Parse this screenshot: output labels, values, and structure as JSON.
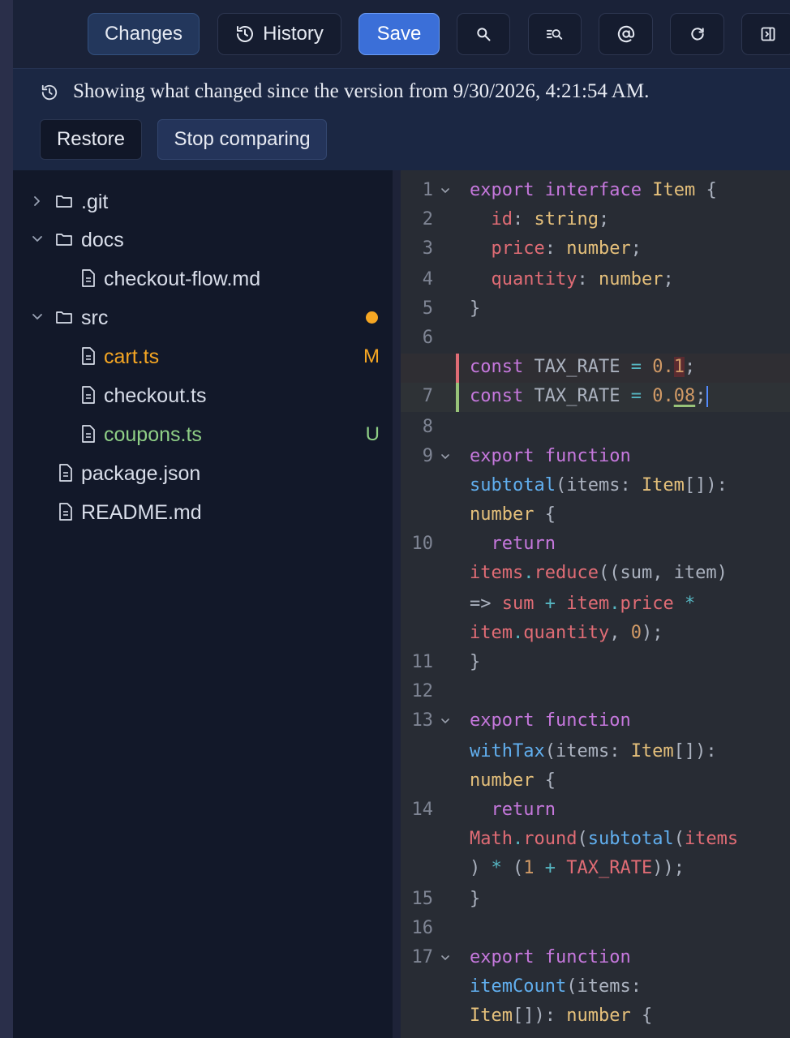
{
  "toolbar": {
    "changes_label": "Changes",
    "history_label": "History",
    "save_label": "Save"
  },
  "banner": {
    "message": "Showing what changed since the version from 9/30/2026, 4:21:54 AM.",
    "restore_label": "Restore",
    "stop_label": "Stop comparing"
  },
  "tree": {
    "git": ".git",
    "docs": "docs",
    "checkout_flow": "checkout-flow.md",
    "src": "src",
    "cart": "cart.ts",
    "cart_status": "M",
    "checkout": "checkout.ts",
    "coupons": "coupons.ts",
    "coupons_status": "U",
    "package": "package.json",
    "readme": "README.md"
  },
  "colors": {
    "modified": "#f5a623",
    "untracked": "#8fcf86",
    "accent": "#3b6fd8"
  },
  "editor": {
    "line_numbers": [
      "1",
      "2",
      "3",
      "4",
      "5",
      "6",
      "7",
      "8",
      "9",
      "10",
      "11",
      "12",
      "13",
      "14",
      "15",
      "16",
      "17"
    ],
    "l1": [
      "export",
      "interface",
      "Item",
      "{"
    ],
    "l2": [
      "id",
      ":",
      "string",
      ";"
    ],
    "l3": [
      "price",
      ":",
      "number",
      ";"
    ],
    "l4": [
      "quantity",
      ":",
      "number",
      ";"
    ],
    "l5": "}",
    "del": [
      "const",
      "TAX_RATE",
      "=",
      "0.",
      "1",
      ";"
    ],
    "l7": [
      "const",
      "TAX_RATE",
      "=",
      "0.",
      "08",
      ";"
    ],
    "l9a": [
      "export",
      "function"
    ],
    "l9b": [
      "subtotal",
      "(items:",
      "Item",
      "[]):"
    ],
    "l9c": [
      "number",
      "{"
    ],
    "l10a": "return",
    "l10b": [
      "items",
      ".",
      "reduce",
      "((sum, item)"
    ],
    "l10c": [
      "=>",
      "sum",
      "+",
      "item",
      ".",
      "price",
      "*"
    ],
    "l10d": [
      "item",
      ".",
      "quantity",
      ", ",
      "0",
      ");"
    ],
    "l11": "}",
    "l13a": [
      "export",
      "function"
    ],
    "l13b": [
      "withTax",
      "(items:",
      "Item",
      "[]):"
    ],
    "l13c": [
      "number",
      "{"
    ],
    "l14a": "return",
    "l14b": [
      "Math",
      ".",
      "round",
      "(",
      "subtotal",
      "(",
      "items"
    ],
    "l14c": [
      ")",
      "*",
      "(",
      "1",
      "+",
      "TAX_RATE",
      "));"
    ],
    "l15": "}",
    "l17a": [
      "export",
      "function"
    ],
    "l17b": [
      "itemCount",
      "(items:"
    ],
    "l17c": [
      "Item",
      "[]):",
      "number",
      "{"
    ]
  }
}
